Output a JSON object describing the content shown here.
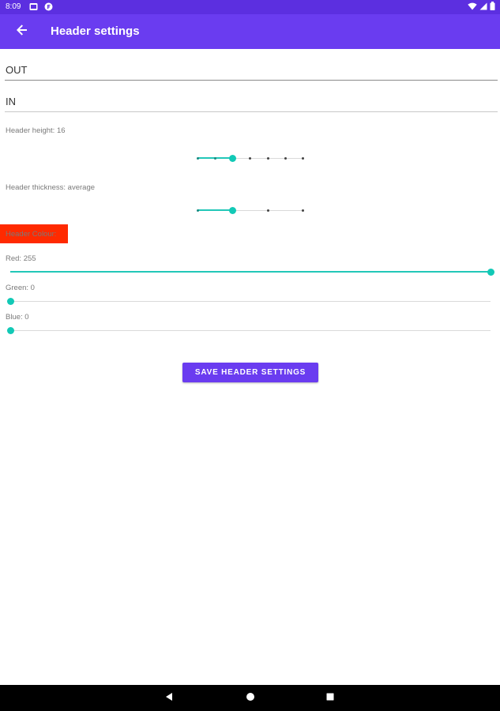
{
  "status_bar": {
    "time": "8:09"
  },
  "app_bar": {
    "title": "Header settings"
  },
  "fields": {
    "out_value": "OUT",
    "in_value": "IN"
  },
  "header_height": {
    "label": "Header height: 16",
    "steps": 7,
    "selected_index": 2
  },
  "header_thickness": {
    "label": "Header thickness: average",
    "steps": 3,
    "selected_index": 1
  },
  "header_colour": {
    "label": "Header Colour:",
    "color": "#ff2a00"
  },
  "rgb": {
    "red": {
      "label": "Red: 255",
      "value": 255,
      "max": 255
    },
    "green": {
      "label": "Green: 0",
      "value": 0,
      "max": 255
    },
    "blue": {
      "label": "Blue: 0",
      "value": 0,
      "max": 255
    }
  },
  "actions": {
    "save_label": "SAVE HEADER SETTINGS"
  },
  "colors": {
    "primary": "#6a3cf0",
    "status_bar": "#5c2fe0",
    "slider_accent": "#12c9b6",
    "nav_bar": "#000000"
  },
  "icons": {
    "back": "arrow-left-icon",
    "wifi": "wifi-icon",
    "signal": "cell-signal-icon",
    "battery": "battery-icon",
    "nav_back": "triangle-back-icon",
    "nav_home": "circle-home-icon",
    "nav_recents": "square-recents-icon"
  }
}
